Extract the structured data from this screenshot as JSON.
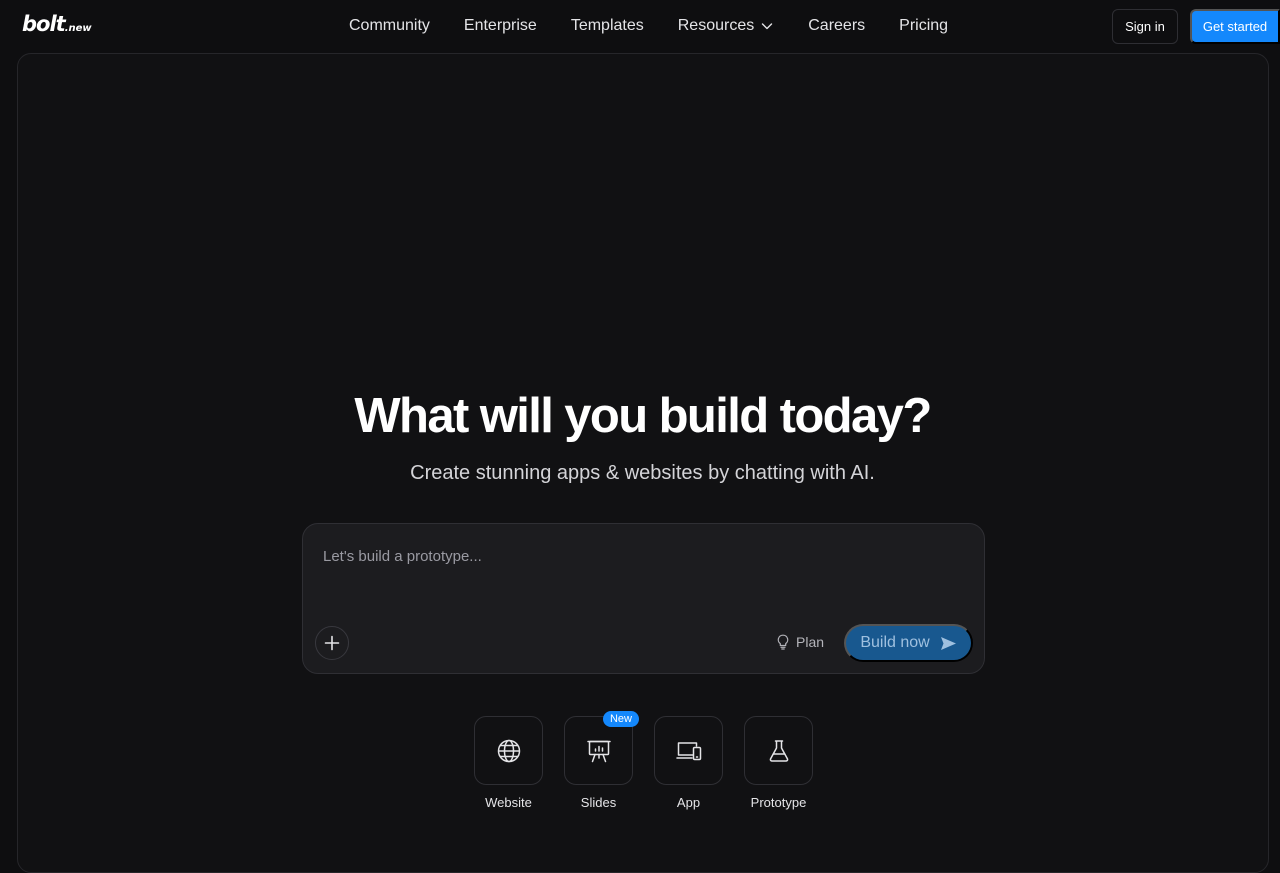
{
  "brand": {
    "name": "bolt",
    "suffix": ".new"
  },
  "nav": [
    {
      "label": "Community"
    },
    {
      "label": "Enterprise"
    },
    {
      "label": "Templates"
    },
    {
      "label": "Resources",
      "dropdown": true
    },
    {
      "label": "Careers"
    },
    {
      "label": "Pricing"
    }
  ],
  "header": {
    "signin_label": "Sign in",
    "get_started_label": "Get started"
  },
  "hero": {
    "title": "What will you build today?",
    "subtitle": "Create stunning apps & websites by chatting with AI."
  },
  "prompt": {
    "placeholder": "Let's build a prototype...",
    "value": "",
    "plan_label": "Plan",
    "build_label": "Build now"
  },
  "types": [
    {
      "label": "Website",
      "icon": "globe-icon"
    },
    {
      "label": "Slides",
      "icon": "presentation-icon",
      "badge": "New"
    },
    {
      "label": "App",
      "icon": "devices-icon"
    },
    {
      "label": "Prototype",
      "icon": "flask-icon"
    }
  ],
  "colors": {
    "accent": "#1488fc",
    "background": "#0e0e10",
    "build_button": "#18588f"
  }
}
